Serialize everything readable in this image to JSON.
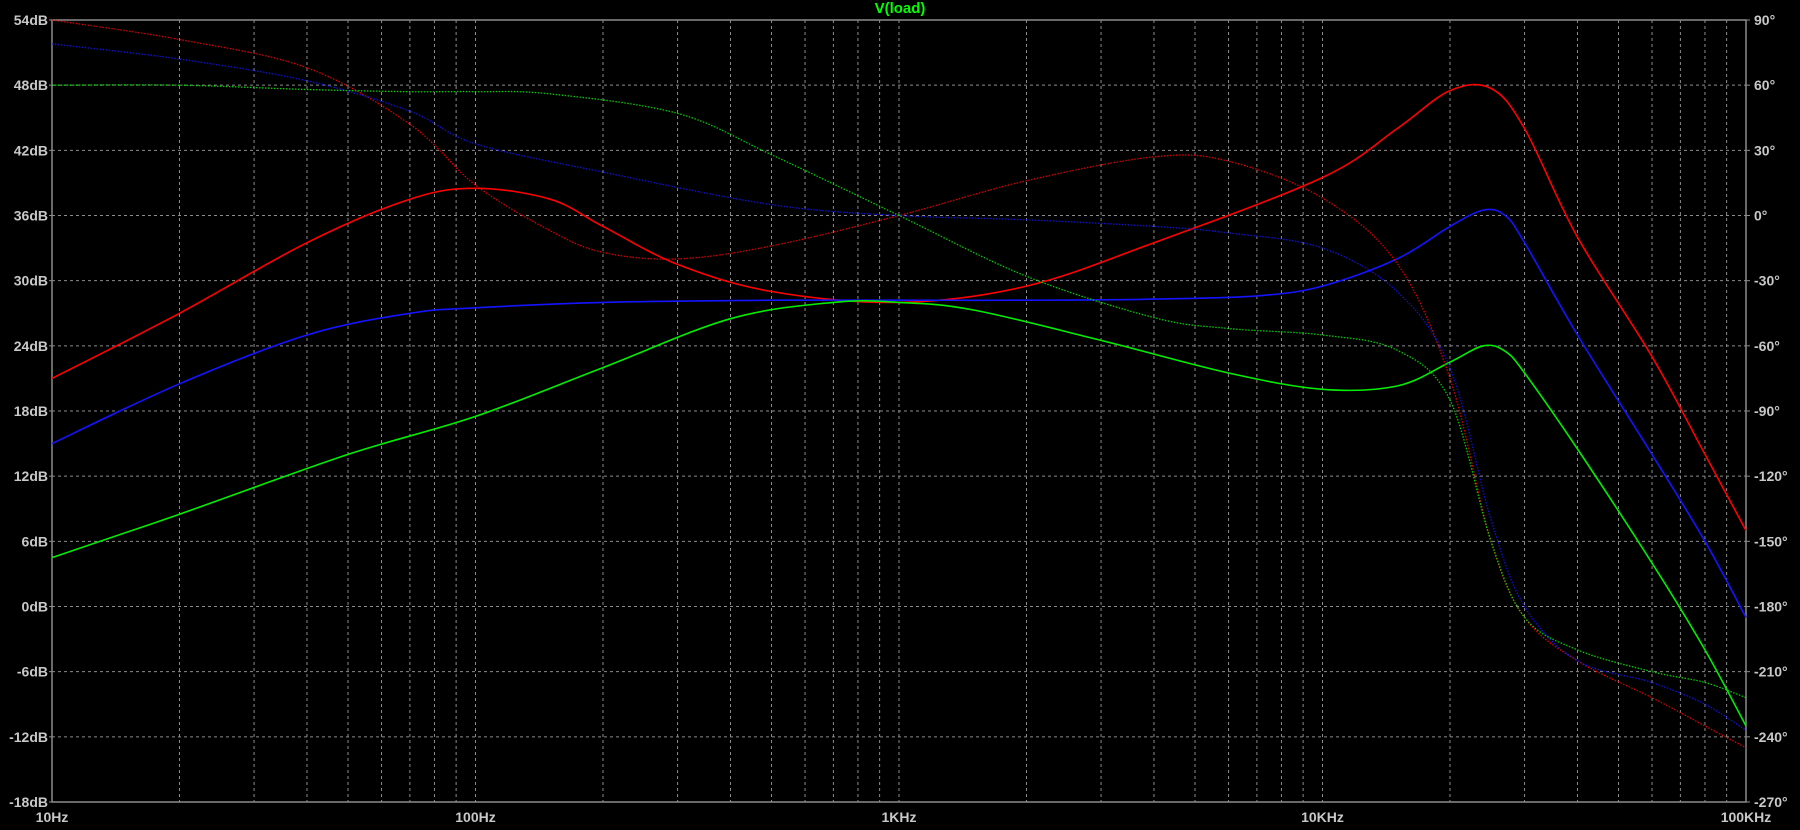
{
  "chart_data": {
    "type": "line",
    "title": "V(load)",
    "x_scale": "log",
    "xlim": [
      10,
      100000
    ],
    "ylim_left": [
      -18,
      54
    ],
    "ylim_right": [
      -270,
      90
    ],
    "grid": true,
    "x_tick_labels": [
      "10Hz",
      "100Hz",
      "1KHz",
      "10KHz",
      "100KHz"
    ],
    "y_left_ticks": [
      "54dB",
      "48dB",
      "42dB",
      "36dB",
      "30dB",
      "24dB",
      "18dB",
      "12dB",
      "6dB",
      "0dB",
      "-6dB",
      "-12dB",
      "-18dB"
    ],
    "y_right_ticks": [
      "90°",
      "60°",
      "30°",
      "0°",
      "-30°",
      "-60°",
      "-90°",
      "-120°",
      "-150°",
      "-180°",
      "-210°",
      "-240°",
      "-270°"
    ],
    "colors": {
      "background": "#000000",
      "grid": "#8c8c8c",
      "title": "#00ff00",
      "red": "#ff0000",
      "blue": "#1414ff",
      "green": "#00ee00"
    },
    "series": [
      {
        "color": "red",
        "axis": "left",
        "style": "solid",
        "points": [
          [
            10,
            21
          ],
          [
            20,
            27
          ],
          [
            40,
            33.5
          ],
          [
            70,
            37.5
          ],
          [
            100,
            38.5
          ],
          [
            150,
            37.5
          ],
          [
            200,
            35
          ],
          [
            300,
            31.5
          ],
          [
            500,
            29
          ],
          [
            1000,
            28
          ],
          [
            2000,
            29.5
          ],
          [
            4000,
            33.5
          ],
          [
            10000,
            39.5
          ],
          [
            15000,
            44
          ],
          [
            20000,
            47.5
          ],
          [
            25000,
            47.7
          ],
          [
            30000,
            44
          ],
          [
            40000,
            34
          ],
          [
            60000,
            23
          ],
          [
            80000,
            14
          ],
          [
            100000,
            7
          ]
        ]
      },
      {
        "color": "blue",
        "axis": "left",
        "style": "solid",
        "points": [
          [
            10,
            15
          ],
          [
            20,
            20.5
          ],
          [
            40,
            25
          ],
          [
            70,
            27
          ],
          [
            100,
            27.5
          ],
          [
            200,
            28
          ],
          [
            500,
            28.2
          ],
          [
            1000,
            28.2
          ],
          [
            2000,
            28.2
          ],
          [
            4000,
            28.3
          ],
          [
            7000,
            28.6
          ],
          [
            10000,
            29.5
          ],
          [
            15000,
            32
          ],
          [
            20000,
            35
          ],
          [
            24000,
            36.5
          ],
          [
            27000,
            36
          ],
          [
            30000,
            33.5
          ],
          [
            40000,
            25
          ],
          [
            60000,
            14
          ],
          [
            80000,
            6
          ],
          [
            100000,
            -1
          ]
        ]
      },
      {
        "color": "green",
        "axis": "left",
        "style": "solid",
        "points": [
          [
            10,
            4.5
          ],
          [
            20,
            8.5
          ],
          [
            50,
            14
          ],
          [
            100,
            17.5
          ],
          [
            200,
            22
          ],
          [
            400,
            26.5
          ],
          [
            700,
            28
          ],
          [
            1000,
            28
          ],
          [
            1500,
            27.3
          ],
          [
            3000,
            24.5
          ],
          [
            6000,
            21.5
          ],
          [
            10000,
            20
          ],
          [
            15000,
            20.3
          ],
          [
            20000,
            22.5
          ],
          [
            24000,
            24
          ],
          [
            27000,
            23.5
          ],
          [
            30000,
            21.5
          ],
          [
            40000,
            14.5
          ],
          [
            60000,
            4
          ],
          [
            80000,
            -4
          ],
          [
            100000,
            -11
          ]
        ]
      },
      {
        "color": "red",
        "axis": "right",
        "style": "dotted",
        "points": [
          [
            10,
            90
          ],
          [
            20,
            81
          ],
          [
            40,
            68
          ],
          [
            70,
            42
          ],
          [
            100,
            14
          ],
          [
            150,
            -7
          ],
          [
            200,
            -17
          ],
          [
            300,
            -20
          ],
          [
            500,
            -14
          ],
          [
            1000,
            0
          ],
          [
            2000,
            16
          ],
          [
            4000,
            27
          ],
          [
            6000,
            25
          ],
          [
            10000,
            8
          ],
          [
            15000,
            -22
          ],
          [
            20000,
            -75
          ],
          [
            25000,
            -150
          ],
          [
            30000,
            -185
          ],
          [
            40000,
            -205
          ],
          [
            60000,
            -222
          ],
          [
            80000,
            -235
          ],
          [
            100000,
            -245
          ]
        ]
      },
      {
        "color": "blue",
        "axis": "right",
        "style": "dotted",
        "points": [
          [
            10,
            79
          ],
          [
            20,
            72
          ],
          [
            40,
            62
          ],
          [
            70,
            48
          ],
          [
            100,
            33
          ],
          [
            200,
            20
          ],
          [
            500,
            5
          ],
          [
            1000,
            0
          ],
          [
            2000,
            -2
          ],
          [
            4000,
            -5
          ],
          [
            6000,
            -8
          ],
          [
            10000,
            -15
          ],
          [
            15000,
            -35
          ],
          [
            20000,
            -70
          ],
          [
            25000,
            -140
          ],
          [
            30000,
            -180
          ],
          [
            40000,
            -205
          ],
          [
            60000,
            -215
          ],
          [
            80000,
            -225
          ],
          [
            100000,
            -237
          ]
        ]
      },
      {
        "color": "green",
        "axis": "right",
        "style": "dotted",
        "points": [
          [
            10,
            60
          ],
          [
            20,
            60
          ],
          [
            40,
            58
          ],
          [
            70,
            57
          ],
          [
            100,
            57
          ],
          [
            150,
            56
          ],
          [
            300,
            47
          ],
          [
            500,
            28
          ],
          [
            1000,
            0
          ],
          [
            2000,
            -28
          ],
          [
            4000,
            -47
          ],
          [
            6000,
            -52
          ],
          [
            10000,
            -55
          ],
          [
            15000,
            -62
          ],
          [
            20000,
            -85
          ],
          [
            25000,
            -150
          ],
          [
            30000,
            -185
          ],
          [
            40000,
            -200
          ],
          [
            60000,
            -210
          ],
          [
            80000,
            -215
          ],
          [
            100000,
            -222
          ]
        ]
      }
    ]
  }
}
